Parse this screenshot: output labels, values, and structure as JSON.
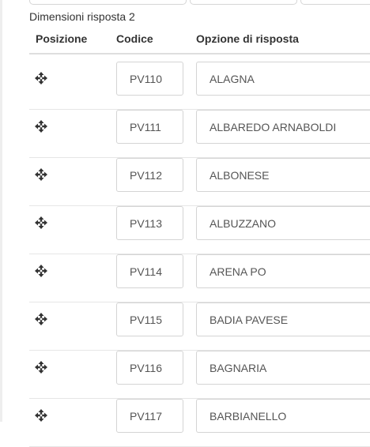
{
  "section": {
    "title": "Dimensioni risposta 2"
  },
  "table": {
    "headers": {
      "position": "Posizione",
      "code": "Codice",
      "option": "Opzione di risposta"
    },
    "rows": [
      {
        "code": "PV110",
        "option": "ALAGNA"
      },
      {
        "code": "PV111",
        "option": "ALBAREDO ARNABOLDI"
      },
      {
        "code": "PV112",
        "option": "ALBONESE"
      },
      {
        "code": "PV113",
        "option": "ALBUZZANO"
      },
      {
        "code": "PV114",
        "option": "ARENA PO"
      },
      {
        "code": "PV115",
        "option": "BADIA PAVESE"
      },
      {
        "code": "PV116",
        "option": "BAGNARIA"
      },
      {
        "code": "PV117",
        "option": "BARBIANELLO"
      }
    ]
  },
  "icons": {
    "drag_handle": "move-arrows-icon"
  }
}
